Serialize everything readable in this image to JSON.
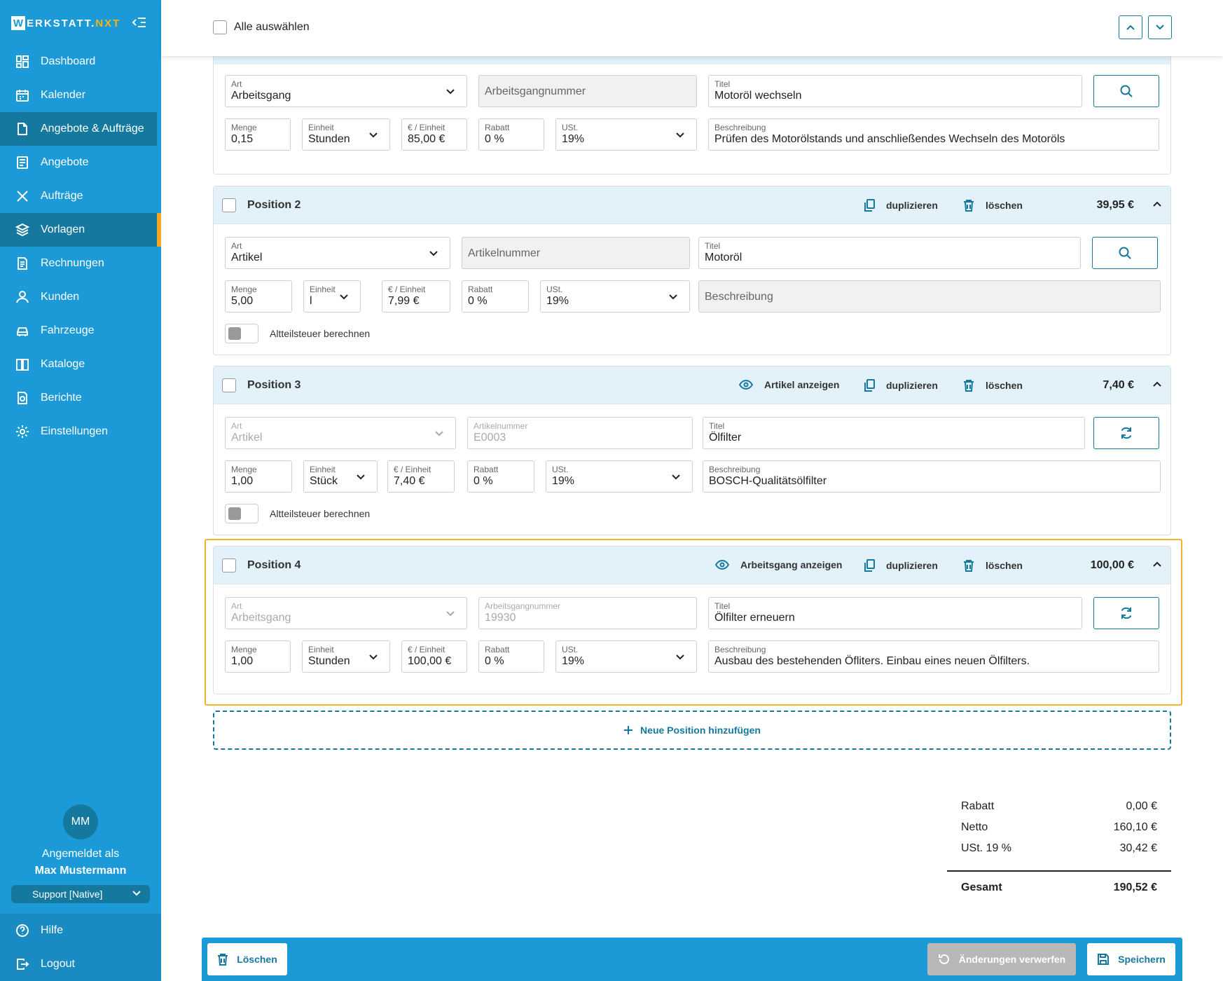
{
  "app": {
    "logo_w": "W",
    "logo_mid": "ERKSTATT.",
    "logo_nxt": "NXT"
  },
  "sidebar": {
    "items": [
      {
        "label": "Dashboard",
        "icon": "dashboard-icon"
      },
      {
        "label": "Kalender",
        "icon": "calendar-icon"
      },
      {
        "label": "Angebote & Aufträge",
        "icon": "document-icon"
      },
      {
        "label": "Angebote",
        "icon": "quote-icon"
      },
      {
        "label": "Aufträge",
        "icon": "tools-icon"
      },
      {
        "label": "Vorlagen",
        "icon": "layers-icon"
      },
      {
        "label": "Rechnungen",
        "icon": "invoice-icon"
      },
      {
        "label": "Kunden",
        "icon": "user-icon"
      },
      {
        "label": "Fahrzeuge",
        "icon": "car-icon"
      },
      {
        "label": "Kataloge",
        "icon": "book-icon"
      },
      {
        "label": "Berichte",
        "icon": "report-icon"
      },
      {
        "label": "Einstellungen",
        "icon": "gear-icon"
      }
    ],
    "avatar": "MM",
    "logged_in_as": "Angemeldet als",
    "user_name": "Max Mustermann",
    "support": "Support [Native]",
    "help": "Hilfe",
    "logout": "Logout"
  },
  "toolbar": {
    "select_all": "Alle auswählen"
  },
  "labels": {
    "art": "Art",
    "titel": "Titel",
    "menge": "Menge",
    "einheit": "Einheit",
    "preis": "€ / Einheit",
    "rabatt": "Rabatt",
    "ust": "USt.",
    "beschreibung": "Beschreibung",
    "arbeitsgangnummer": "Arbeitsgangnummer",
    "artikelnummer": "Artikelnummer",
    "altteil": "Altteilsteuer berechnen",
    "duplizieren": "duplizieren",
    "loeschen": "löschen",
    "artikel_anzeigen": "Artikel anzeigen",
    "arbeitsgang_anzeigen": "Arbeitsgang anzeigen"
  },
  "positions": [
    {
      "art": "Arbeitsgang",
      "nummer_placeholder": "Arbeitsgangnummer",
      "titel": "Motoröl wechseln",
      "menge": "0,15",
      "einheit": "Stunden",
      "preis": "85,00 €",
      "rabatt": "0 %",
      "ust": "19%",
      "beschreibung": "Prüfen des Motorölstands und anschließendes Wechseln des Motoröls"
    },
    {
      "title": "Position 2",
      "price": "39,95 €",
      "art": "Artikel",
      "nummer_placeholder": "Artikelnummer",
      "titel": "Motoröl",
      "menge": "5,00",
      "einheit": "l",
      "preis": "7,99 €",
      "rabatt": "0 %",
      "ust": "19%",
      "beschreibung_placeholder": "Beschreibung"
    },
    {
      "title": "Position 3",
      "price": "7,40 €",
      "art": "Artikel",
      "nummer": "E0003",
      "titel": "Ölfilter",
      "menge": "1,00",
      "einheit": "Stück",
      "preis": "7,40 €",
      "rabatt": "0 %",
      "ust": "19%",
      "beschreibung": "BOSCH-Qualitätsölfilter"
    },
    {
      "title": "Position 4",
      "price": "100,00 €",
      "art": "Arbeitsgang",
      "nummer": "19930",
      "titel": "Ölfilter erneuern",
      "menge": "1,00",
      "einheit": "Stunden",
      "preis": "100,00 €",
      "rabatt": "0 %",
      "ust": "19%",
      "beschreibung": "Ausbau des bestehenden Öfliters. Einbau eines neuen Ölfilters."
    }
  ],
  "add_position": "Neue Position hinzufügen",
  "totals": {
    "rabatt_label": "Rabatt",
    "rabatt": "0,00 €",
    "netto_label": "Netto",
    "netto": "160,10 €",
    "ust_label": "USt. 19 %",
    "ust": "30,42 €",
    "gesamt_label": "Gesamt",
    "gesamt": "190,52 €"
  },
  "actions": {
    "delete": "Löschen",
    "discard": "Änderungen verwerfen",
    "save": "Speichern"
  },
  "colors": {
    "primary": "#1b9ad7",
    "dark": "#15799f",
    "accent": "#f5a623",
    "highlight": "#f0b429"
  }
}
